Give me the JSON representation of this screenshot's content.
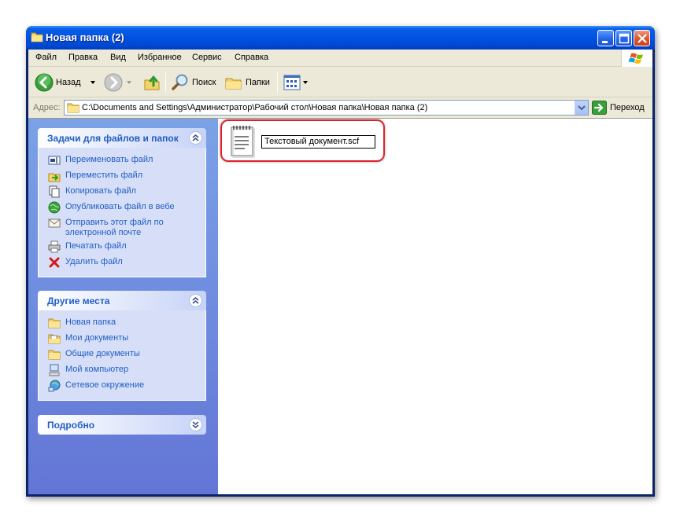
{
  "window": {
    "title": "Новая папка (2)"
  },
  "menu": {
    "items": [
      "Файл",
      "Правка",
      "Вид",
      "Избранное",
      "Сервис",
      "Справка"
    ]
  },
  "toolbar": {
    "back_label": "Назад",
    "search_label": "Поиск",
    "folders_label": "Папки"
  },
  "address": {
    "label": "Адрес:",
    "path": "C:\\Documents and Settings\\Администратор\\Рабочий стол\\Новая папка\\Новая папка (2)",
    "go_label": "Переход"
  },
  "panels": {
    "file_tasks": {
      "title": "Задачи для файлов и папок",
      "items": [
        {
          "label": "Переименовать файл",
          "icon": "rename-icon"
        },
        {
          "label": "Переместить файл",
          "icon": "move-icon"
        },
        {
          "label": "Копировать файл",
          "icon": "copy-icon"
        },
        {
          "label": "Опубликовать файл в вебе",
          "icon": "globe-icon"
        },
        {
          "label": "Отправить этот файл по электронной почте",
          "icon": "email-icon"
        },
        {
          "label": "Печатать файл",
          "icon": "printer-icon"
        },
        {
          "label": "Удалить файл",
          "icon": "delete-icon"
        }
      ]
    },
    "other_places": {
      "title": "Другие места",
      "items": [
        {
          "label": "Новая папка",
          "icon": "folder-icon"
        },
        {
          "label": "Мои документы",
          "icon": "my-documents-icon"
        },
        {
          "label": "Общие документы",
          "icon": "shared-folder-icon"
        },
        {
          "label": "Мой компьютер",
          "icon": "my-computer-icon"
        },
        {
          "label": "Сетевое окружение",
          "icon": "network-icon"
        }
      ]
    },
    "details": {
      "title": "Подробно"
    }
  },
  "file": {
    "name_editing": "Текстовый документ.scf",
    "icon": "notepad-document-icon"
  },
  "colors": {
    "titlebar": "#0054e3",
    "sidebar": "#7ba2e7",
    "task_link": "#215dc6",
    "highlight": "#e2202d"
  }
}
